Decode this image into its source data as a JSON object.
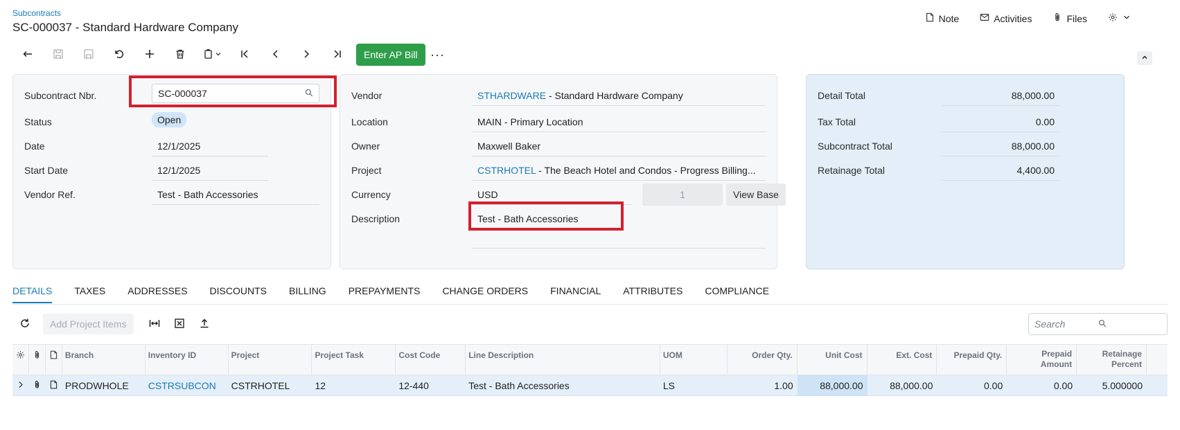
{
  "header": {
    "breadcrumb": "Subcontracts",
    "title": "SC-000037 - Standard Hardware Company",
    "actions": {
      "note": "Note",
      "activities": "Activities",
      "files": "Files"
    }
  },
  "toolbar": {
    "enter_ap_bill": "Enter AP Bill",
    "more": "···"
  },
  "summary": {
    "subcontract_nbr": {
      "label": "Subcontract Nbr.",
      "value": "SC-000037"
    },
    "status": {
      "label": "Status",
      "value": "Open"
    },
    "date": {
      "label": "Date",
      "value": "12/1/2025"
    },
    "start_date": {
      "label": "Start Date",
      "value": "12/1/2025"
    },
    "vendor_ref": {
      "label": "Vendor Ref.",
      "value": "Test - Bath Accessories"
    }
  },
  "vendor_panel": {
    "vendor": {
      "label": "Vendor",
      "code": "STHARDWARE",
      "name": " - Standard Hardware Company"
    },
    "location": {
      "label": "Location",
      "value": "MAIN - Primary Location"
    },
    "owner": {
      "label": "Owner",
      "value": "Maxwell Baker"
    },
    "project": {
      "label": "Project",
      "code": "CSTRHOTEL",
      "name": " - The Beach Hotel and Condos - Progress Billing..."
    },
    "currency": {
      "label": "Currency",
      "value": "USD",
      "rate": "1",
      "view_base": "View Base"
    },
    "description": {
      "label": "Description",
      "value": "Test - Bath Accessories"
    }
  },
  "totals": {
    "detail_total": {
      "label": "Detail Total",
      "value": "88,000.00"
    },
    "tax_total": {
      "label": "Tax Total",
      "value": "0.00"
    },
    "subcontract_total": {
      "label": "Subcontract Total",
      "value": "88,000.00"
    },
    "retainage_total": {
      "label": "Retainage Total",
      "value": "4,400.00"
    }
  },
  "tabs": [
    "DETAILS",
    "TAXES",
    "ADDRESSES",
    "DISCOUNTS",
    "BILLING",
    "PREPAYMENTS",
    "CHANGE ORDERS",
    "FINANCIAL",
    "ATTRIBUTES",
    "COMPLIANCE"
  ],
  "grid_toolbar": {
    "add_project_items": "Add Project Items",
    "search_placeholder": "Search"
  },
  "grid": {
    "columns": {
      "branch": "Branch",
      "inventory_id": "Inventory ID",
      "project": "Project",
      "project_task": "Project Task",
      "cost_code": "Cost Code",
      "line_description": "Line Description",
      "uom": "UOM",
      "order_qty": "Order Qty.",
      "unit_cost": "Unit Cost",
      "ext_cost": "Ext. Cost",
      "prepaid_qty": "Prepaid Qty.",
      "prepaid_amount_1": "Prepaid",
      "prepaid_amount_2": "Amount",
      "retainage_percent_1": "Retainage",
      "retainage_percent_2": "Percent"
    },
    "rows": [
      {
        "branch": "PRODWHOLE",
        "inventory_id": "CSTRSUBCON",
        "project": "CSTRHOTEL",
        "project_task": "12",
        "cost_code": "12-440",
        "line_description": "Test - Bath Accessories",
        "uom": "LS",
        "order_qty": "1.00",
        "unit_cost": "88,000.00",
        "ext_cost": "88,000.00",
        "prepaid_qty": "0.00",
        "prepaid_amount": "0.00",
        "retainage_percent": "5.000000"
      }
    ]
  }
}
